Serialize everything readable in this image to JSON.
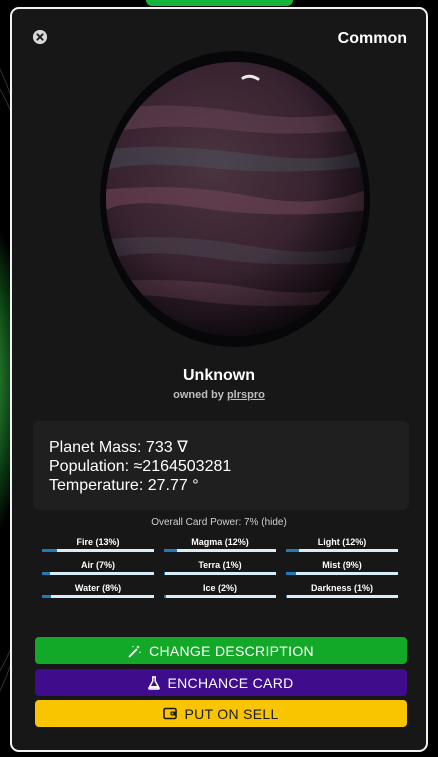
{
  "card": {
    "rarity": "Common",
    "planet_name": "Unknown",
    "owner_prefix": "owned by ",
    "owner_name": "plrspro",
    "stats": [
      "Planet Mass: 733 ∇",
      "Population: ≈2164503281",
      "Temperature: 27.77 °"
    ],
    "power_text": "Overall Card Power: 7% ",
    "power_hide": "(hide)",
    "elements": [
      {
        "label": "Fire (13%)",
        "percent": 13
      },
      {
        "label": "Magma (12%)",
        "percent": 12
      },
      {
        "label": "Light (12%)",
        "percent": 12
      },
      {
        "label": "Air (7%)",
        "percent": 7
      },
      {
        "label": "Terra (1%)",
        "percent": 1
      },
      {
        "label": "Mist (9%)",
        "percent": 9
      },
      {
        "label": "Water (8%)",
        "percent": 8
      },
      {
        "label": "Ice (2%)",
        "percent": 2
      },
      {
        "label": "Darkness (1%)",
        "percent": 1
      }
    ]
  },
  "buttons": {
    "change_description": "CHANGE DESCRIPTION",
    "enchance_card": "ENCHANCE CARD",
    "put_on_sell": "PUT ON SELL"
  },
  "icons": {
    "close": "close-icon",
    "wand": "magic-wand-icon",
    "flask": "flask-icon",
    "wallet": "wallet-icon"
  },
  "colors": {
    "change_description": "#13a928",
    "enchance_card": "#3f0c8c",
    "put_on_sell": "#f8c500",
    "element_fill": "#1f7ab8",
    "element_track": "#d7eef8"
  }
}
